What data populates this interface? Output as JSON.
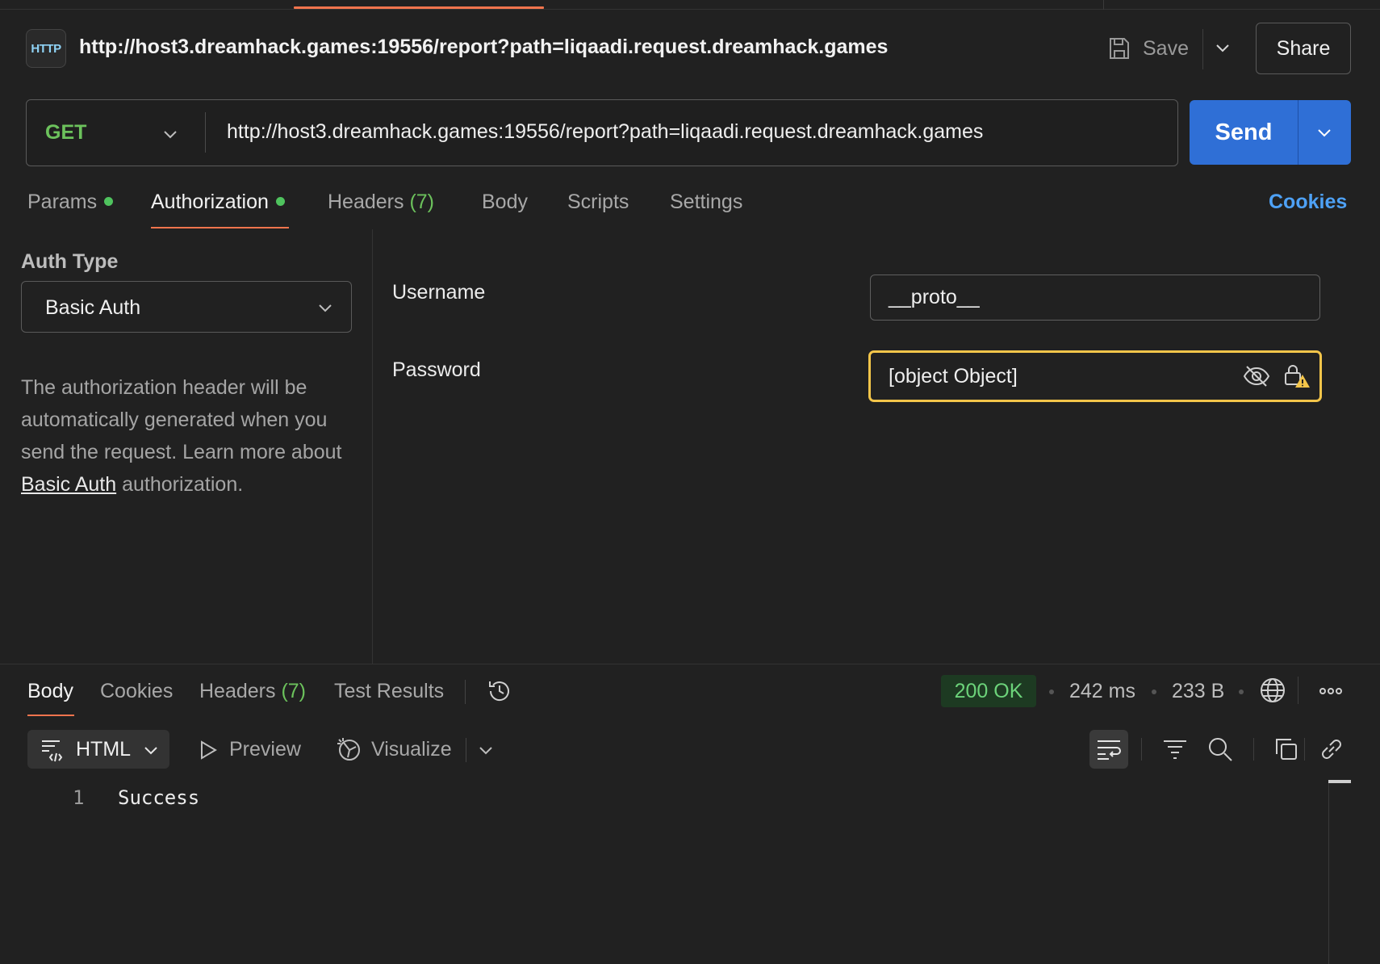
{
  "header": {
    "icon_label": "HTTP",
    "title": "http://host3.dreamhack.games:19556/report?path=liqaadi.request.dreamhack.games",
    "save_label": "Save",
    "share_label": "Share"
  },
  "request": {
    "method": "GET",
    "url": "http://host3.dreamhack.games:19556/report?path=liqaadi.request.dreamhack.games",
    "send_label": "Send"
  },
  "request_tabs": {
    "params": "Params",
    "authorization": "Authorization",
    "headers": "Headers",
    "headers_count": "(7)",
    "body": "Body",
    "scripts": "Scripts",
    "settings": "Settings",
    "cookies": "Cookies",
    "active": "Authorization"
  },
  "auth": {
    "type_label": "Auth Type",
    "type_value": "Basic Auth",
    "desc_1": "The authorization header will be automatically generated when you send the request. Learn more about ",
    "desc_link": "Basic Auth",
    "desc_2": " authorization.",
    "username_label": "Username",
    "username_value": "__proto__",
    "password_label": "Password",
    "password_value": "[object Object]"
  },
  "response": {
    "tabs": {
      "body": "Body",
      "cookies": "Cookies",
      "headers": "Headers",
      "headers_count": "(7)",
      "test_results": "Test Results",
      "active": "Body"
    },
    "status": "200 OK",
    "time": "242 ms",
    "size": "233 B",
    "format": "HTML",
    "preview_label": "Preview",
    "visualize_label": "Visualize",
    "lines": [
      {
        "number": "1",
        "text": "Success"
      }
    ]
  },
  "colors": {
    "accent": "#f2744d",
    "send": "#2f6fd6",
    "method": "#6cc25c",
    "warning": "#f3c54a",
    "link": "#4ea1f5"
  }
}
